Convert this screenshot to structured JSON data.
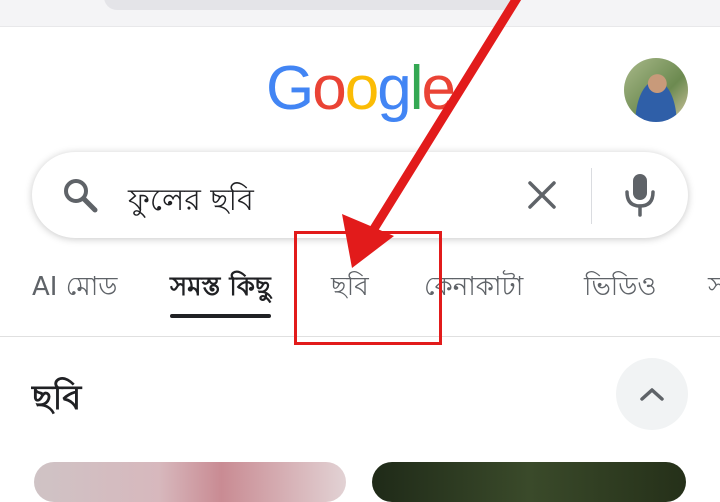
{
  "logo": {
    "letters": [
      "G",
      "o",
      "o",
      "g",
      "l",
      "e"
    ],
    "colors": [
      "#4285F4",
      "#EA4335",
      "#FBBC05",
      "#4285F4",
      "#34A853",
      "#EA4335"
    ]
  },
  "search": {
    "query": "ফুলের ছবি"
  },
  "tabs": [
    {
      "label": "AI মোড",
      "active": false
    },
    {
      "label": "সমস্ত কিছু",
      "active": true
    },
    {
      "label": "ছবি",
      "active": false
    },
    {
      "label": "কেনাকাটা",
      "active": false
    },
    {
      "label": "ভিডিও",
      "active": false
    },
    {
      "label": "স",
      "active": false
    }
  ],
  "section": {
    "title": "ছবি"
  },
  "icons": {
    "search": "search-icon",
    "clear": "close-icon",
    "mic": "microphone-icon",
    "collapse": "chevron-up-icon"
  },
  "colors": {
    "annotation": "#e21b1b"
  }
}
